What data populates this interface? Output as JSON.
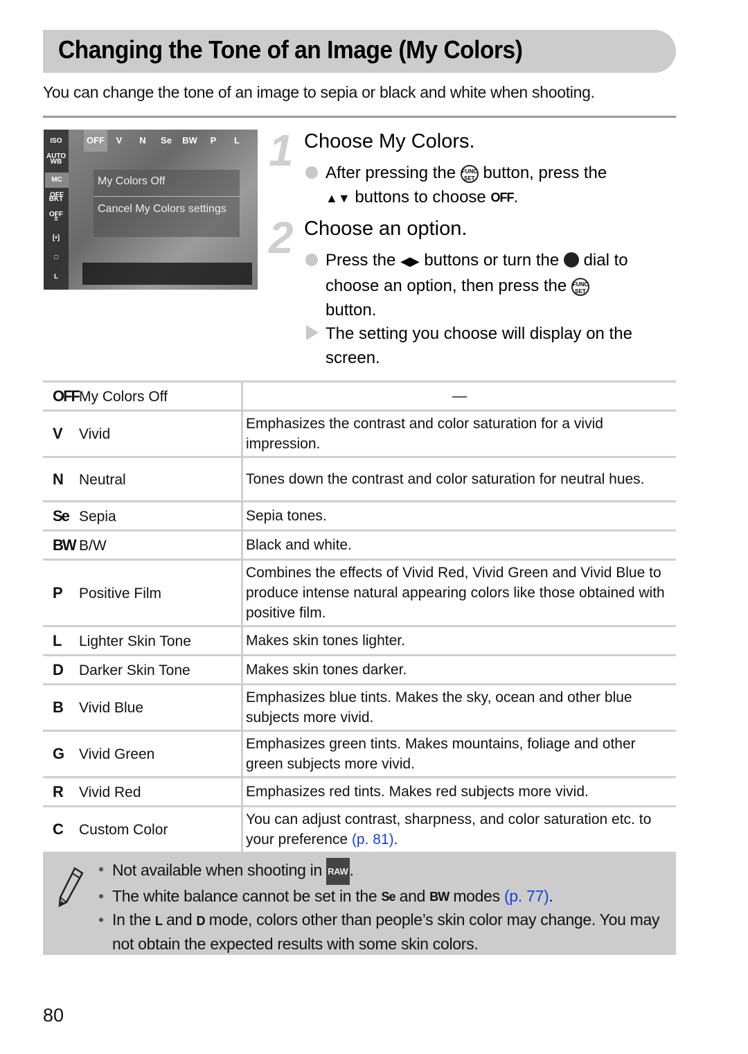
{
  "header": {
    "title": "Changing the Tone of an Image (My Colors)",
    "intro": "You can change the tone of an image to sepia or black and white when shooting."
  },
  "lcd_screen": {
    "sidebar_items": [
      "ISO AUTO",
      "WB",
      "MC OFF",
      "BKT OFF",
      "±",
      "[•]",
      "□",
      "L"
    ],
    "selected_sidebar": "MC OFF",
    "overlay_title": "My Colors Off",
    "overlay_description": "Cancel My Colors settings",
    "bottom_options": [
      "OFF",
      "V",
      "N",
      "Se",
      "BW",
      "P",
      "L"
    ],
    "selected_option": "OFF"
  },
  "steps": [
    {
      "number": "1",
      "title": "Choose My Colors.",
      "instructions": [
        {
          "type": "bullet",
          "text_before": "After pressing the",
          "icon": "func-set-button-icon",
          "text_after": "button, press the",
          "line2_icon": "up-down-arrows-icon",
          "line2_arrows": "▲▼",
          "line2_text": "buttons to choose",
          "line2_icon2": "my-colors-off-icon",
          "line2_glyph": "OFF",
          "line2_end": "."
        }
      ]
    },
    {
      "number": "2",
      "title": "Choose an option.",
      "instructions": [
        {
          "type": "bullet",
          "l1_before": "Press the",
          "l1_arrows": "◀▶",
          "l1_mid": "buttons or turn the",
          "l1_after": "dial to",
          "l2_before": "choose an option, then press the",
          "l3": "button."
        },
        {
          "type": "result",
          "text": "The setting you choose will display on the screen.",
          "l1": "The setting you choose will display on the",
          "l2": "screen."
        }
      ]
    }
  ],
  "options_table": {
    "rows": [
      {
        "icon": "my-colors-off-icon",
        "glyph": "OFF",
        "name": "My Colors Off",
        "description": "—"
      },
      {
        "icon": "vivid-icon",
        "glyph": "V",
        "name": "Vivid",
        "description": "Emphasizes the contrast and color saturation for a vivid impression."
      },
      {
        "icon": "neutral-icon",
        "glyph": "N",
        "name": "Neutral",
        "description": "Tones down the contrast and color saturation for neutral hues."
      },
      {
        "icon": "sepia-icon",
        "glyph": "Se",
        "name": "Sepia",
        "description": "Sepia tones."
      },
      {
        "icon": "bw-icon",
        "glyph": "BW",
        "name": "B/W",
        "description": "Black and white."
      },
      {
        "icon": "positive-film-icon",
        "glyph": "P",
        "name": "Positive Film",
        "description": "Combines the effects of Vivid Red, Vivid Green and Vivid Blue to produce intense natural appearing colors like those obtained with positive film."
      },
      {
        "icon": "lighter-skin-tone-icon",
        "glyph": "L",
        "name": "Lighter Skin Tone",
        "description": "Makes skin tones lighter."
      },
      {
        "icon": "darker-skin-tone-icon",
        "glyph": "D",
        "name": "Darker Skin Tone",
        "description": "Makes skin tones darker."
      },
      {
        "icon": "vivid-blue-icon",
        "glyph": "B",
        "name": "Vivid Blue",
        "description": "Emphasizes blue tints. Makes the sky, ocean and other blue subjects more vivid."
      },
      {
        "icon": "vivid-green-icon",
        "glyph": "G",
        "name": "Vivid Green",
        "description": "Emphasizes green tints. Makes mountains, foliage and other green subjects more vivid."
      },
      {
        "icon": "vivid-red-icon",
        "glyph": "R",
        "name": "Vivid Red",
        "description": "Emphasizes red tints. Makes red subjects more vivid."
      },
      {
        "icon": "custom-color-icon",
        "glyph": "C",
        "name": "Custom Color",
        "description": "You can adjust contrast, sharpness, and color saturation etc. to your preference",
        "link": "(p. 81)",
        "end": "."
      }
    ]
  },
  "note": {
    "icon": "pencil-icon",
    "items": [
      {
        "before": "Not available when shooting in",
        "raw_label": "RAW",
        "after": "."
      },
      {
        "before": "The white balance cannot be set in the",
        "g1": "Se",
        "mid": "and",
        "g2": "BW",
        "after": "modes",
        "link": "(p. 77)",
        "end": "."
      },
      {
        "before": "In the",
        "g1": "L",
        "mid": "and",
        "g2": "D",
        "after": "mode, colors other than people’s skin color may change. You may not obtain the expected results with some skin colors."
      }
    ]
  },
  "page_number": "80",
  "colors": {
    "link": "#1a3fd6",
    "title_bar": "#cccccc",
    "note_bg": "#cccccc"
  }
}
